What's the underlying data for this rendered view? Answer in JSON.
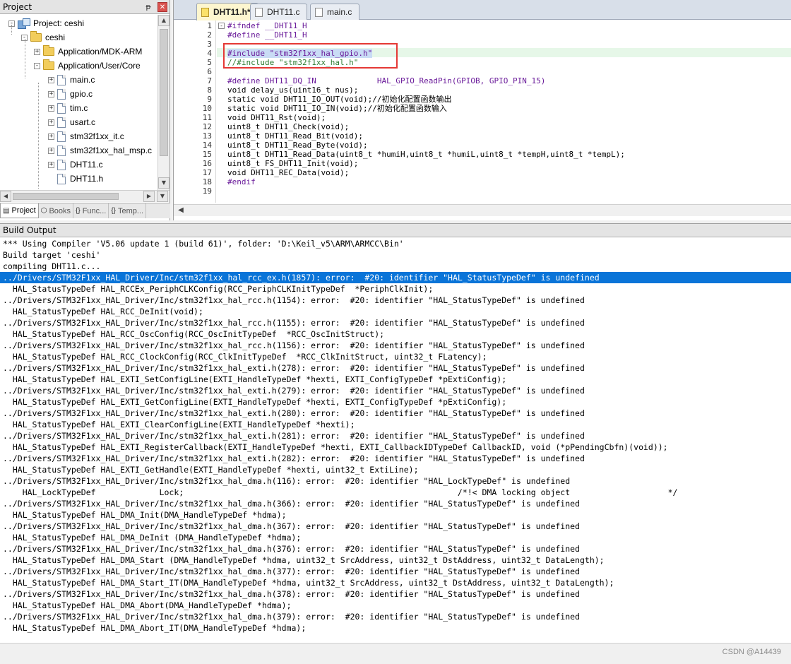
{
  "project_panel": {
    "title": "Project",
    "pin_icon": "pin-icon",
    "close_icon": "close-icon",
    "tree": [
      {
        "label": "Project: ceshi",
        "level": 0,
        "type": "project",
        "expander": "-"
      },
      {
        "label": "ceshi",
        "level": 1,
        "type": "folder",
        "expander": "-"
      },
      {
        "label": "Application/MDK-ARM",
        "level": 2,
        "type": "folder",
        "expander": "+"
      },
      {
        "label": "Application/User/Core",
        "level": 2,
        "type": "folder",
        "expander": "-"
      },
      {
        "label": "main.c",
        "level": 3,
        "type": "file",
        "expander": "+"
      },
      {
        "label": "gpio.c",
        "level": 3,
        "type": "file",
        "expander": "+"
      },
      {
        "label": "tim.c",
        "level": 3,
        "type": "file",
        "expander": "+"
      },
      {
        "label": "usart.c",
        "level": 3,
        "type": "file",
        "expander": "+"
      },
      {
        "label": "stm32f1xx_it.c",
        "level": 3,
        "type": "file",
        "expander": "+"
      },
      {
        "label": "stm32f1xx_hal_msp.c",
        "level": 3,
        "type": "file",
        "expander": "+"
      },
      {
        "label": "DHT11.c",
        "level": 3,
        "type": "file",
        "expander": "+"
      },
      {
        "label": "DHT11.h",
        "level": 3,
        "type": "file",
        "expander": ""
      }
    ],
    "tabs": [
      {
        "label": "Project",
        "icon": "project-icon",
        "glyph": "▤",
        "active": true
      },
      {
        "label": "Books",
        "icon": "books-icon",
        "glyph": "⬡",
        "active": false
      },
      {
        "label": "Func...",
        "icon": "functions-icon",
        "glyph": "{}",
        "active": false
      },
      {
        "label": "Temp...",
        "icon": "templates-icon",
        "glyph": "{}",
        "active": false
      }
    ]
  },
  "editor": {
    "tabs": [
      {
        "label": "DHT11.h*",
        "active": true
      },
      {
        "label": "DHT11.c",
        "active": false
      },
      {
        "label": "main.c",
        "active": false
      }
    ],
    "lines": [
      {
        "n": "1",
        "text": "#ifndef __DHT11_H",
        "cls": "c-pp",
        "fold": "-"
      },
      {
        "n": "2",
        "text": "#define __DHT11_H",
        "cls": "c-pp",
        "fold": ""
      },
      {
        "n": "3",
        "text": "",
        "cls": "",
        "fold": ""
      },
      {
        "n": "4",
        "text": "#include \"stm32f1xx_hal_gpio.h\"",
        "cls": "c-pp",
        "fold": "",
        "selected": true
      },
      {
        "n": "5",
        "text": "//#include \"stm32f1xx_hal.h\"",
        "cls": "c-cm",
        "fold": ""
      },
      {
        "n": "6",
        "text": "",
        "cls": "",
        "fold": ""
      },
      {
        "n": "7",
        "text": "#define DHT11_DQ_IN             HAL_GPIO_ReadPin(GPIOB, GPIO_PIN_15)",
        "cls": "c-pp",
        "fold": ""
      },
      {
        "n": "8",
        "text": "void delay_us(uint16_t nus);",
        "cls": "",
        "fold": ""
      },
      {
        "n": "9",
        "text": "static void DHT11_IO_OUT(void);//初始化配置函数输出",
        "cls": "",
        "fold": ""
      },
      {
        "n": "10",
        "text": "static void DHT11_IO_IN(void);//初始化配置函数输入",
        "cls": "",
        "fold": ""
      },
      {
        "n": "11",
        "text": "void DHT11_Rst(void);",
        "cls": "",
        "fold": ""
      },
      {
        "n": "12",
        "text": "uint8_t DHT11_Check(void);",
        "cls": "",
        "fold": ""
      },
      {
        "n": "13",
        "text": "uint8_t DHT11_Read_Bit(void);",
        "cls": "",
        "fold": ""
      },
      {
        "n": "14",
        "text": "uint8_t DHT11_Read_Byte(void);",
        "cls": "",
        "fold": ""
      },
      {
        "n": "15",
        "text": "uint8_t DHT11_Read_Data(uint8_t *humiH,uint8_t *humiL,uint8_t *tempH,uint8_t *tempL);",
        "cls": "",
        "fold": ""
      },
      {
        "n": "16",
        "text": "uint8_t FS_DHT11_Init(void);",
        "cls": "",
        "fold": ""
      },
      {
        "n": "17",
        "text": "void DHT11_REC_Data(void);",
        "cls": "",
        "fold": ""
      },
      {
        "n": "18",
        "text": "#endif",
        "cls": "c-pp",
        "fold": ""
      },
      {
        "n": "19",
        "text": "",
        "cls": "",
        "fold": ""
      }
    ]
  },
  "build_output": {
    "title": "Build Output",
    "selected_index": 3,
    "lines": [
      "*** Using Compiler 'V5.06 update 1 (build 61)', folder: 'D:\\Keil_v5\\ARM\\ARMCC\\Bin'",
      "Build target 'ceshi'",
      "compiling DHT11.c...",
      "../Drivers/STM32F1xx_HAL_Driver/Inc/stm32f1xx_hal_rcc_ex.h(1857): error:  #20: identifier \"HAL_StatusTypeDef\" is undefined",
      "  HAL_StatusTypeDef HAL_RCCEx_PeriphCLKConfig(RCC_PeriphCLKInitTypeDef  *PeriphClkInit);",
      "../Drivers/STM32F1xx_HAL_Driver/Inc/stm32f1xx_hal_rcc.h(1154): error:  #20: identifier \"HAL_StatusTypeDef\" is undefined",
      "  HAL_StatusTypeDef HAL_RCC_DeInit(void);",
      "../Drivers/STM32F1xx_HAL_Driver/Inc/stm32f1xx_hal_rcc.h(1155): error:  #20: identifier \"HAL_StatusTypeDef\" is undefined",
      "  HAL_StatusTypeDef HAL_RCC_OscConfig(RCC_OscInitTypeDef  *RCC_OscInitStruct);",
      "../Drivers/STM32F1xx_HAL_Driver/Inc/stm32f1xx_hal_rcc.h(1156): error:  #20: identifier \"HAL_StatusTypeDef\" is undefined",
      "  HAL_StatusTypeDef HAL_RCC_ClockConfig(RCC_ClkInitTypeDef  *RCC_ClkInitStruct, uint32_t FLatency);",
      "../Drivers/STM32F1xx_HAL_Driver/Inc/stm32f1xx_hal_exti.h(278): error:  #20: identifier \"HAL_StatusTypeDef\" is undefined",
      "  HAL_StatusTypeDef HAL_EXTI_SetConfigLine(EXTI_HandleTypeDef *hexti, EXTI_ConfigTypeDef *pExtiConfig);",
      "../Drivers/STM32F1xx_HAL_Driver/Inc/stm32f1xx_hal_exti.h(279): error:  #20: identifier \"HAL_StatusTypeDef\" is undefined",
      "  HAL_StatusTypeDef HAL_EXTI_GetConfigLine(EXTI_HandleTypeDef *hexti, EXTI_ConfigTypeDef *pExtiConfig);",
      "../Drivers/STM32F1xx_HAL_Driver/Inc/stm32f1xx_hal_exti.h(280): error:  #20: identifier \"HAL_StatusTypeDef\" is undefined",
      "  HAL_StatusTypeDef HAL_EXTI_ClearConfigLine(EXTI_HandleTypeDef *hexti);",
      "../Drivers/STM32F1xx_HAL_Driver/Inc/stm32f1xx_hal_exti.h(281): error:  #20: identifier \"HAL_StatusTypeDef\" is undefined",
      "  HAL_StatusTypeDef HAL_EXTI_RegisterCallback(EXTI_HandleTypeDef *hexti, EXTI_CallbackIDTypeDef CallbackID, void (*pPendingCbfn)(void));",
      "../Drivers/STM32F1xx_HAL_Driver/Inc/stm32f1xx_hal_exti.h(282): error:  #20: identifier \"HAL_StatusTypeDef\" is undefined",
      "  HAL_StatusTypeDef HAL_EXTI_GetHandle(EXTI_HandleTypeDef *hexti, uint32_t ExtiLine);",
      "../Drivers/STM32F1xx_HAL_Driver/Inc/stm32f1xx_hal_dma.h(116): error:  #20: identifier \"HAL_LockTypeDef\" is undefined",
      "    HAL_LockTypeDef             Lock;                                                        /*!< DMA locking object                    */",
      "../Drivers/STM32F1xx_HAL_Driver/Inc/stm32f1xx_hal_dma.h(366): error:  #20: identifier \"HAL_StatusTypeDef\" is undefined",
      "  HAL_StatusTypeDef HAL_DMA_Init(DMA_HandleTypeDef *hdma);",
      "../Drivers/STM32F1xx_HAL_Driver/Inc/stm32f1xx_hal_dma.h(367): error:  #20: identifier \"HAL_StatusTypeDef\" is undefined",
      "  HAL_StatusTypeDef HAL_DMA_DeInit (DMA_HandleTypeDef *hdma);",
      "../Drivers/STM32F1xx_HAL_Driver/Inc/stm32f1xx_hal_dma.h(376): error:  #20: identifier \"HAL_StatusTypeDef\" is undefined",
      "  HAL_StatusTypeDef HAL_DMA_Start (DMA_HandleTypeDef *hdma, uint32_t SrcAddress, uint32_t DstAddress, uint32_t DataLength);",
      "../Drivers/STM32F1xx_HAL_Driver/Inc/stm32f1xx_hal_dma.h(377): error:  #20: identifier \"HAL_StatusTypeDef\" is undefined",
      "  HAL_StatusTypeDef HAL_DMA_Start_IT(DMA_HandleTypeDef *hdma, uint32_t SrcAddress, uint32_t DstAddress, uint32_t DataLength);",
      "../Drivers/STM32F1xx_HAL_Driver/Inc/stm32f1xx_hal_dma.h(378): error:  #20: identifier \"HAL_StatusTypeDef\" is undefined",
      "  HAL_StatusTypeDef HAL_DMA_Abort(DMA_HandleTypeDef *hdma);",
      "../Drivers/STM32F1xx_HAL_Driver/Inc/stm32f1xx_hal_dma.h(379): error:  #20: identifier \"HAL_StatusTypeDef\" is undefined",
      "  HAL_StatusTypeDef HAL_DMA_Abort_IT(DMA_HandleTypeDef *hdma);"
    ]
  },
  "watermark": "CSDN @A14439",
  "colors": {
    "selection": "#0a74d8",
    "highlight_box": "#e53935",
    "current_line": "#e6f7e8"
  }
}
